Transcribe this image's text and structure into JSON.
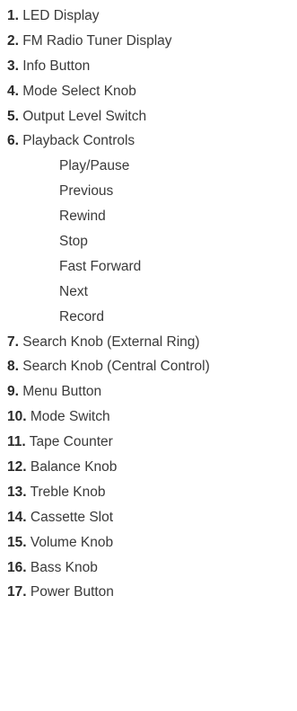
{
  "legend": {
    "items": [
      {
        "num": "1.",
        "label": "LED Display"
      },
      {
        "num": "2.",
        "label": "FM Radio Tuner Display"
      },
      {
        "num": "3.",
        "label": "Info Button"
      },
      {
        "num": "4.",
        "label": "Mode Select Knob"
      },
      {
        "num": "5.",
        "label": "Output Level Switch"
      },
      {
        "num": "6.",
        "label": "Playback Controls"
      },
      {
        "num": "",
        "label": "Play/Pause"
      },
      {
        "num": "",
        "label": "Previous"
      },
      {
        "num": "",
        "label": "Rewind"
      },
      {
        "num": "",
        "label": "Stop"
      },
      {
        "num": "",
        "label": "Fast Forward"
      },
      {
        "num": "",
        "label": "Next"
      },
      {
        "num": "",
        "label": "Record"
      },
      {
        "num": "7.",
        "label": "Search Knob (External Ring)"
      },
      {
        "num": "8.",
        "label": "Search Knob (Central Control)"
      },
      {
        "num": "9.",
        "label": "Menu Button"
      },
      {
        "num": "10.",
        "label": "Mode Switch"
      },
      {
        "num": "11.",
        "label": "Tape Counter"
      },
      {
        "num": "12.",
        "label": "Balance Knob"
      },
      {
        "num": "13.",
        "label": "Treble Knob"
      },
      {
        "num": "14.",
        "label": "Cassette Slot"
      },
      {
        "num": "15.",
        "label": "Volume Knob"
      },
      {
        "num": "16.",
        "label": "Bass Knob"
      },
      {
        "num": "17.",
        "label": "Power Button"
      }
    ]
  }
}
